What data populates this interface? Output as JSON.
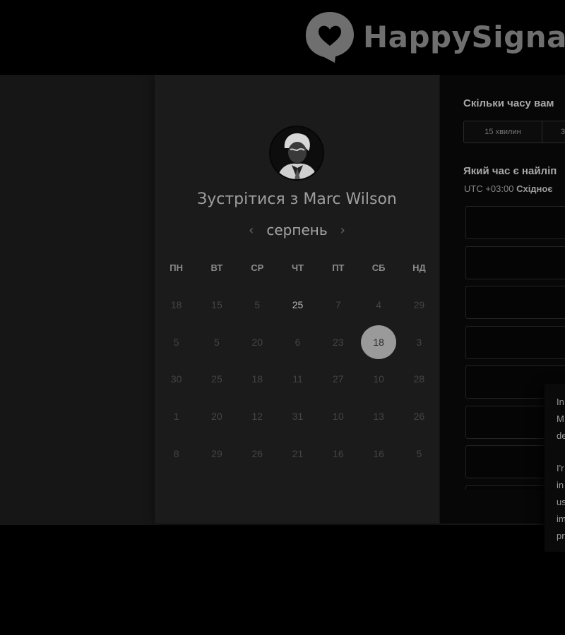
{
  "header": {
    "brand_name": "HappySignals",
    "logo_icon": "heart-speech-bubble-icon"
  },
  "calendar": {
    "title_prefix": "Зустрітися з ",
    "host_name": "Marc Wilson",
    "avatar_icon": "host-avatar",
    "prev_icon": "chevron-left-icon",
    "next_icon": "chevron-right-icon",
    "prev_symbol": "‹",
    "next_symbol": "›",
    "month": "серпень",
    "weekdays": [
      "ПН",
      "ВТ",
      "СР",
      "ЧТ",
      "ПТ",
      "СБ",
      "НД"
    ],
    "weeks": [
      [
        "18",
        "15",
        "5",
        "25",
        "7",
        "4",
        "29"
      ],
      [
        "5",
        "5",
        "20",
        "6",
        "23",
        "18",
        "3"
      ],
      [
        "30",
        "25",
        "18",
        "11",
        "27",
        "10",
        "28"
      ],
      [
        "1",
        "20",
        "12",
        "31",
        "10",
        "13",
        "26"
      ],
      [
        "8",
        "29",
        "26",
        "21",
        "16",
        "16",
        "5"
      ]
    ],
    "active_day": "25",
    "selected_day": "18"
  },
  "scheduler": {
    "duration_question": "Скільки часу вам",
    "duration_options": [
      "15 хвилин",
      "3"
    ],
    "time_question": "Який час є найліп",
    "timezone_offset": "UTC +03:00",
    "timezone_name": "Східноє",
    "slot_count": 8
  },
  "cookie_popup": {
    "paragraph1": "In\nM\nde",
    "paragraph2": "I'r\nin\nus\nim\npr"
  },
  "colors": {
    "page_background": "#000000",
    "panel_background": "#1b1b1b",
    "selected_day": "#9a9a9a",
    "logo": "#6f6f6f"
  }
}
